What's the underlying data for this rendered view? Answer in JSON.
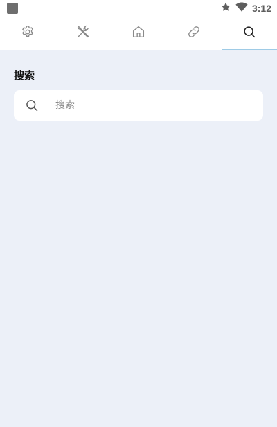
{
  "status_bar": {
    "time": "3:12",
    "icons": [
      "notification-square-icon",
      "star-icon",
      "wifi-icon"
    ]
  },
  "tabs": [
    {
      "icon": "gear-icon",
      "active": false
    },
    {
      "icon": "tools-icon",
      "active": false
    },
    {
      "icon": "home-icon",
      "active": false
    },
    {
      "icon": "link-icon",
      "active": false
    },
    {
      "icon": "search-icon",
      "active": true
    }
  ],
  "search_section": {
    "title": "搜索",
    "placeholder": "搜索"
  },
  "colors": {
    "background": "#ecf0f8",
    "active_tab_indicator": "#9ecbe6",
    "icon_gray": "#8a8a8a",
    "icon_active": "#222222"
  }
}
